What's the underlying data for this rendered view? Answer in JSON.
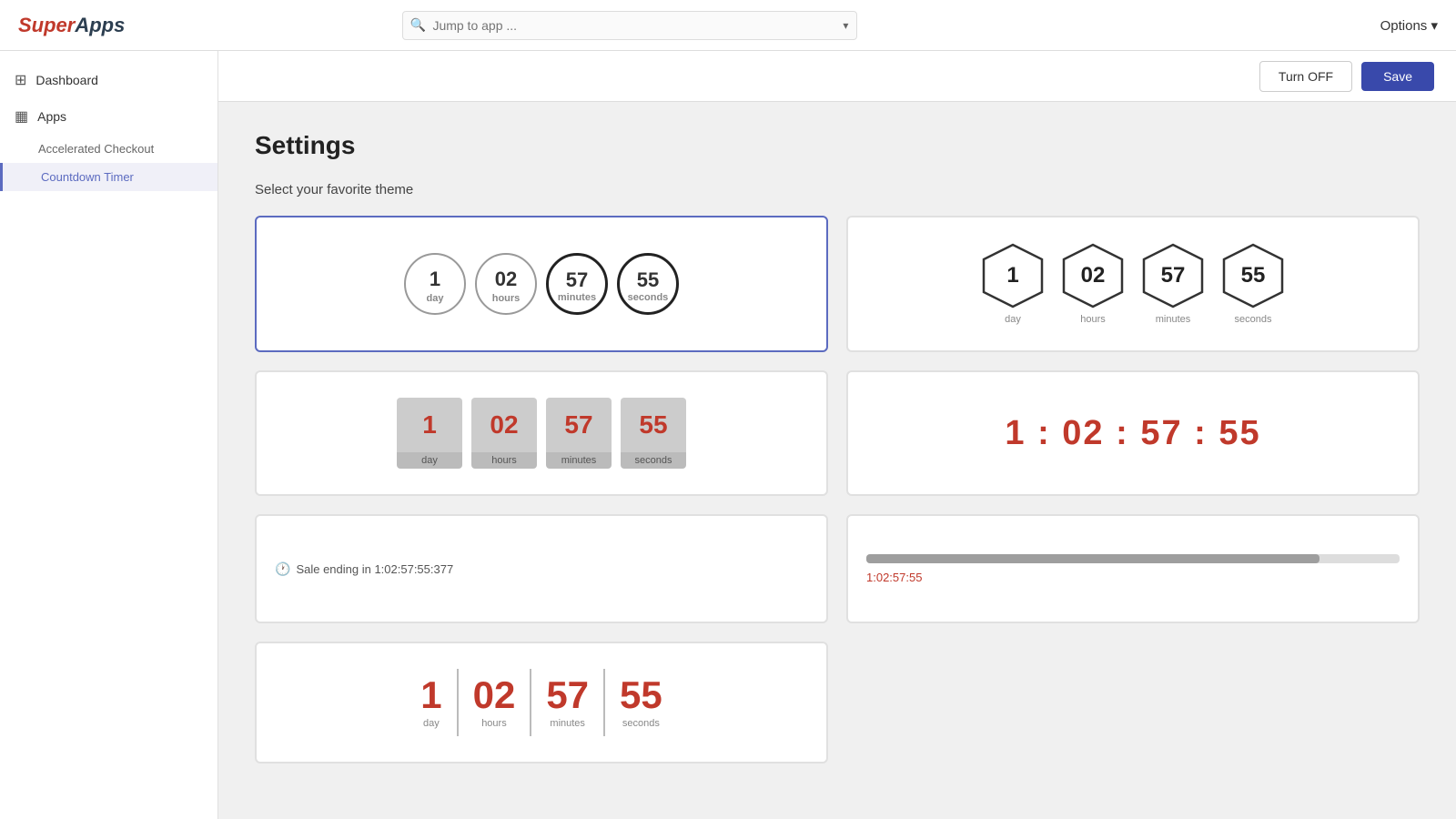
{
  "logo": "SuperApps",
  "search": {
    "placeholder": "Jump to app ..."
  },
  "topbar": {
    "options_label": "Options ▾"
  },
  "header_actions": {
    "turn_off_label": "Turn OFF",
    "save_label": "Save"
  },
  "sidebar": {
    "dashboard_label": "Dashboard",
    "apps_label": "Apps",
    "accelerated_checkout_label": "Accelerated Checkout",
    "countdown_timer_label": "Countdown Timer"
  },
  "page": {
    "title": "Settings",
    "theme_section_label": "Select your favorite theme"
  },
  "timer": {
    "day": "1",
    "day_label": "day",
    "hours": "02",
    "hours_label": "hours",
    "minutes": "57",
    "minutes_label": "minutes",
    "seconds": "55",
    "seconds_label": "seconds",
    "colon_display": "1 : 02 : 57 : 55",
    "text_display": "Sale ending in 1:02:57:55:377",
    "progress_time": "1:02:57:55",
    "progress_percent": "85"
  }
}
